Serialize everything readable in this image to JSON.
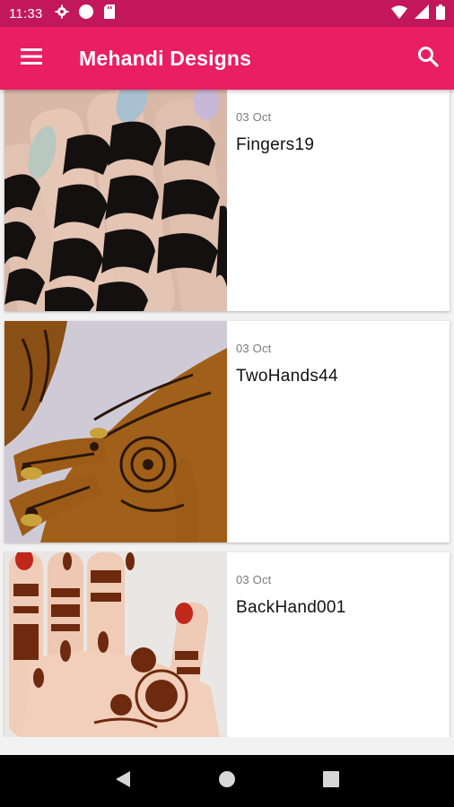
{
  "status_bar": {
    "time": "11:33",
    "icons_left": [
      "settings-icon",
      "circle-icon",
      "sd-card-icon"
    ],
    "icons_right": [
      "wifi-icon",
      "signal-icon",
      "battery-icon"
    ]
  },
  "app_bar": {
    "title": "Mehandi Designs",
    "menu_icon": "menu-icon",
    "search_icon": "search-icon",
    "background": "#e91e63",
    "status_background": "#c2185b"
  },
  "designs": [
    {
      "date": "03 Oct",
      "title": "Fingers19"
    },
    {
      "date": "03 Oct",
      "title": "TwoHands44"
    },
    {
      "date": "03 Oct",
      "title": "BackHand001"
    }
  ],
  "nav_bar": {
    "icons": [
      "back-icon",
      "home-icon",
      "recents-icon"
    ]
  }
}
